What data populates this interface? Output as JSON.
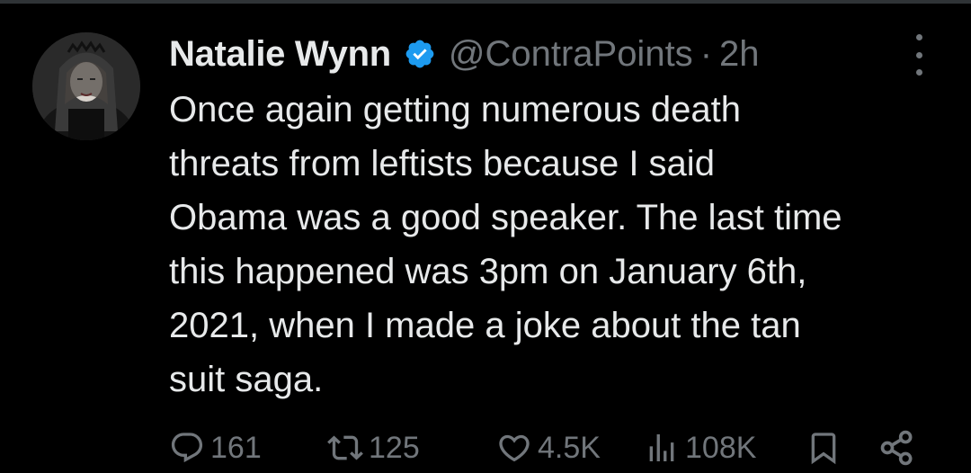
{
  "tweet": {
    "display_name": "Natalie Wynn",
    "handle": "@ContraPoints",
    "separator": "·",
    "time": "2h",
    "text_lines": [
      "Once again getting numerous death",
      "threats from leftists because I said",
      "Obama was a good speaker. The last time",
      "this happened was 3pm on January 6th,",
      "2021, when I made a joke about the tan",
      "suit saga."
    ]
  },
  "actions": {
    "replies": "161",
    "retweets": "125",
    "likes": "4.5K",
    "views": "108K"
  },
  "icons": {
    "verified": "verified-badge-icon",
    "more": "more-options-icon",
    "reply": "reply-icon",
    "retweet": "retweet-icon",
    "like": "heart-icon",
    "views": "views-chart-icon",
    "bookmark": "bookmark-icon",
    "share": "share-icon"
  },
  "colors": {
    "background": "#000000",
    "text_primary": "#e7e9ea",
    "text_secondary": "#71767b",
    "verified_blue": "#1d9bf0"
  }
}
